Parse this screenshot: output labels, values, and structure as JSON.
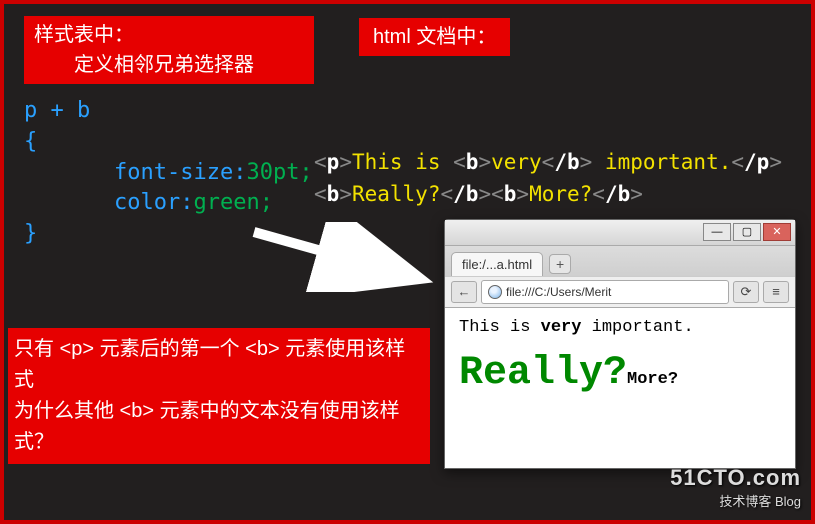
{
  "labels": {
    "css_title_line1": "样式表中：",
    "css_title_line2": "定义相邻兄弟选择器",
    "html_title": "html 文档中："
  },
  "css_code": {
    "selector": "p + b",
    "brace_open": "{",
    "prop1_name": "font-size:",
    "prop1_val": "30pt;",
    "prop2_name": "color:",
    "prop2_val": "green;",
    "brace_close": "}"
  },
  "html_code": {
    "line1_parts": {
      "open_p": "p",
      "txt1": "This is ",
      "open_b": "b",
      "txt2": "very",
      "close_b": "/b",
      "txt3": " important.",
      "close_p": "/p"
    },
    "line2_parts": {
      "open_b1": "b",
      "txt1": "Really?",
      "close_b1": "/b",
      "open_b2": "b",
      "txt2": "More?",
      "close_b2": "/b"
    }
  },
  "explanation": {
    "line1": "只有 <p> 元素后的第一个 <b> 元素使用该样式",
    "line2": "为什么其他 <b> 元素中的文本没有使用该样式？"
  },
  "browser": {
    "tab_label": "file:/...a.html",
    "tab_plus": "+",
    "nav_back": "←",
    "url": "file:///C:/Users/Merit",
    "reload": "⟳",
    "menu": "≡",
    "win_min": "—",
    "win_max": "▢",
    "win_close": "✕",
    "content": {
      "p_prefix": "This is ",
      "p_bold": "very",
      "p_suffix": " important.",
      "really": "Really?",
      "more": "More?"
    }
  },
  "watermark": {
    "top": "51CTO.com",
    "bottom": "技术博客   Blog"
  }
}
